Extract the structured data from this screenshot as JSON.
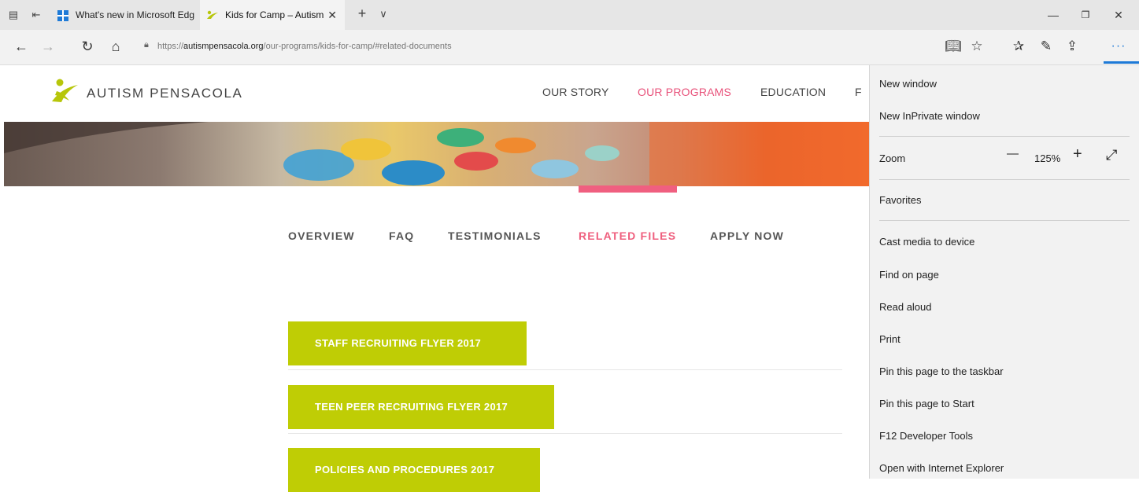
{
  "browser": {
    "tabs": [
      {
        "title": "What's new in Microsoft Edg",
        "active": false
      },
      {
        "title": "Kids for Camp – Autism",
        "active": true
      }
    ],
    "new_tab_label": "+",
    "tab_list_label": "∨",
    "address": {
      "scheme": "https://",
      "domain": "autismpensacola.org",
      "path": "/our-programs/kids-for-camp/#related-documents"
    },
    "accent_color": "#1e7ad7"
  },
  "site": {
    "logo_text": "AUTISM PENSACOLA",
    "nav": [
      "OUR STORY",
      "OUR PROGRAMS",
      "EDUCATION",
      "F"
    ],
    "active_nav": "OUR PROGRAMS",
    "subnav": [
      "OVERVIEW",
      "FAQ",
      "TESTIMONIALS",
      "RELATED FILES",
      "APPLY NOW"
    ],
    "active_subnav": "RELATED FILES",
    "files": [
      "STAFF RECRUITING FLYER 2017",
      "TEEN PEER RECRUITING FLYER 2017",
      "POLICIES AND PROCEDURES 2017"
    ],
    "brand_pink": "#ef5f7e",
    "button_green": "#bfcd05"
  },
  "menu": {
    "new_window": "New window",
    "new_inprivate": "New InPrivate window",
    "zoom_label": "Zoom",
    "zoom_minus": "—",
    "zoom_value": "125%",
    "zoom_plus": "+",
    "zoom_full": "⤢",
    "favorites": "Favorites",
    "cast": "Cast media to device",
    "find": "Find on page",
    "read_aloud": "Read aloud",
    "print": "Print",
    "pin_taskbar": "Pin this page to the taskbar",
    "pin_start": "Pin this page to Start",
    "dev_tools": "F12 Developer Tools",
    "open_ie": "Open with Internet Explorer"
  }
}
